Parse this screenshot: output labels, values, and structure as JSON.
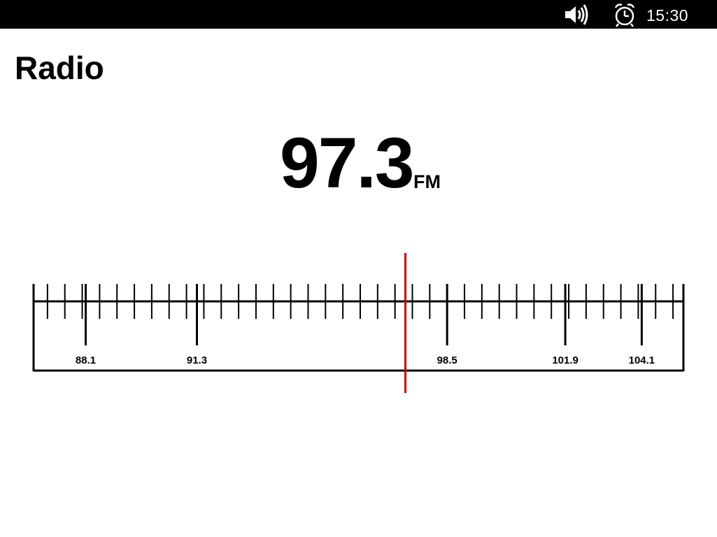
{
  "status_bar": {
    "volume_icon": "speaker-volume-icon",
    "alarm_icon": "alarm-clock-icon",
    "time": "15:30"
  },
  "title": "Radio",
  "tuner": {
    "frequency": "97.3",
    "band": "FM"
  },
  "dial": {
    "min_frequency": 86.6,
    "max_frequency": 105.3,
    "current_frequency": 97.3,
    "minor_tick_step": 0.5,
    "stations": [
      {
        "frequency": 88.1,
        "label": "88.1"
      },
      {
        "frequency": 91.3,
        "label": "91.3"
      },
      {
        "frequency": 98.5,
        "label": "98.5"
      },
      {
        "frequency": 101.9,
        "label": "101.9"
      },
      {
        "frequency": 104.1,
        "label": "104.1"
      }
    ],
    "needle_color": "#cc0000"
  }
}
